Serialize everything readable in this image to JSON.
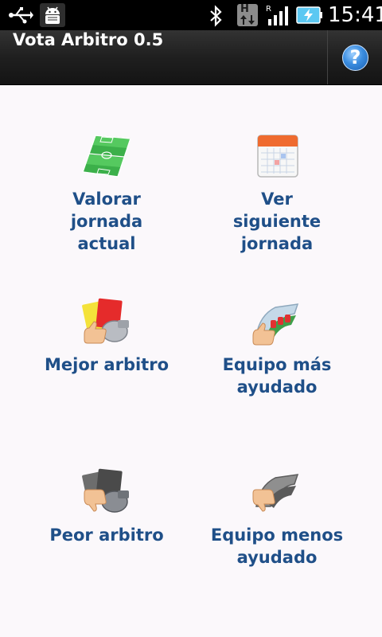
{
  "status_bar": {
    "time": "15:41",
    "network_type": "H",
    "roaming": "R",
    "icons": [
      "usb-icon",
      "android-debug-icon",
      "bluetooth-icon",
      "hspa-icon",
      "signal-icon",
      "battery-charging-icon"
    ]
  },
  "app": {
    "title": "Vota Arbitro 0.5",
    "help_icon": "help-icon",
    "help_glyph": "?"
  },
  "menu": {
    "items": [
      {
        "label": "Valorar\njornada\nactual",
        "icon": "soccer-field-icon"
      },
      {
        "label": "Ver\nsiguiente\njornada",
        "icon": "calendar-icon"
      },
      {
        "label": "Mejor arbitro",
        "icon": "referee-thumbs-up-icon"
      },
      {
        "label": "Equipo más\nayudado",
        "icon": "team-thumbs-up-icon"
      },
      {
        "label": "Peor arbitro",
        "icon": "referee-thumbs-down-icon"
      },
      {
        "label": "Equipo menos\nayudado",
        "icon": "team-thumbs-down-icon"
      }
    ]
  },
  "colors": {
    "label": "#1f4f88",
    "background": "#fbf8fb",
    "titlebar": "#1f1f1f"
  }
}
